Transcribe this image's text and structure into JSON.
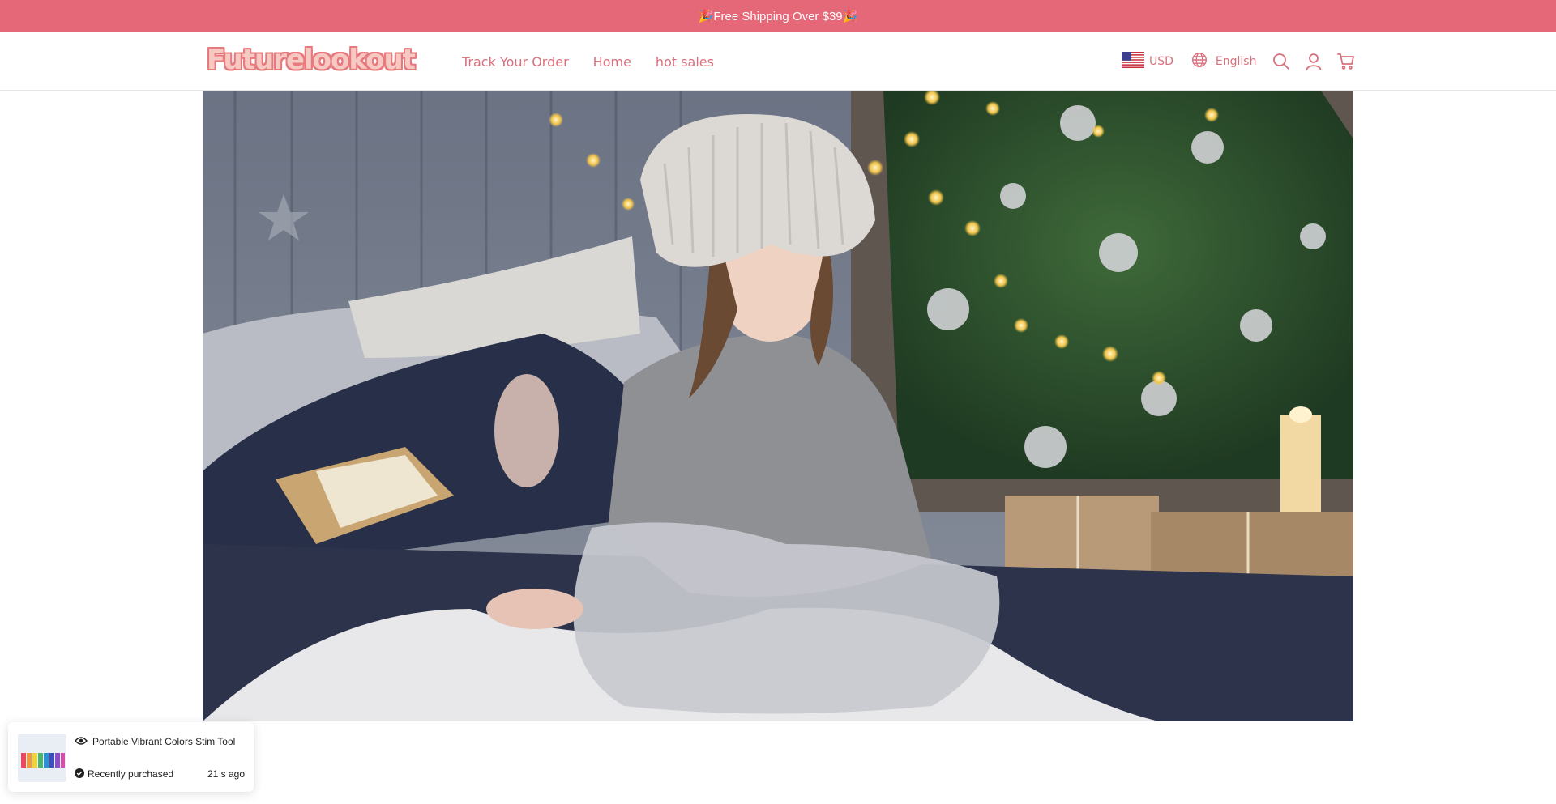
{
  "announcement": {
    "text": "🎉Free Shipping Over $39🎉"
  },
  "brand": {
    "logo_text": "Futurelookout"
  },
  "nav": {
    "items": [
      {
        "label": "Track Your Order"
      },
      {
        "label": "Home"
      },
      {
        "label": "hot sales"
      }
    ]
  },
  "header_tools": {
    "currency": "USD",
    "language": "English",
    "icons": [
      "us-flag-icon",
      "globe-icon",
      "search-icon",
      "user-icon",
      "cart-icon"
    ]
  },
  "hero": {
    "image": "girl-in-knit-hat-by-christmas-tree-photo"
  },
  "purchase_toast": {
    "product_name": "Portable Vibrant Colors Stim Tool",
    "status": "Recently purchased",
    "time_ago": "21 s ago",
    "icons": [
      "eye-icon",
      "check-circle-icon"
    ]
  },
  "colors": {
    "accent": "#e46877",
    "nav_text": "#d9707c",
    "logo_fill": "#f6c9c2",
    "logo_outline": "#e77a7e"
  }
}
